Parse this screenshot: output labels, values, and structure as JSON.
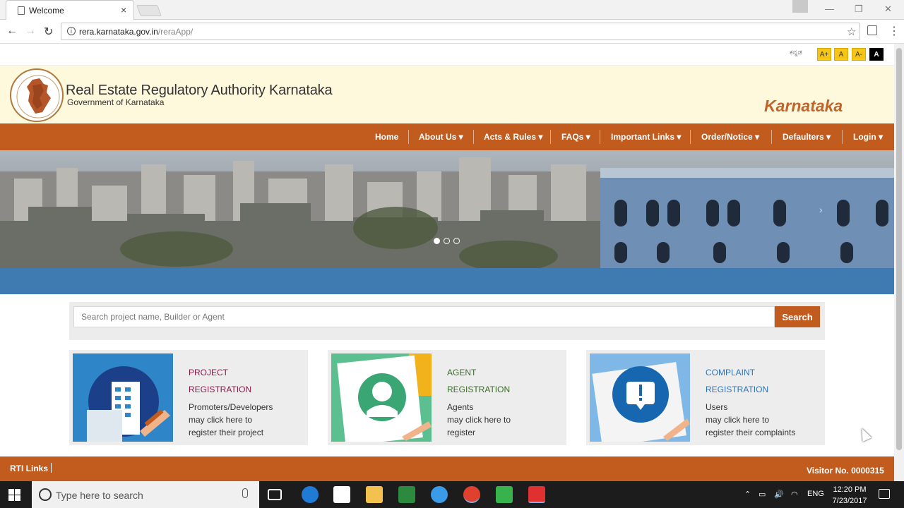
{
  "browser": {
    "tab_title": "Welcome",
    "tab_close": "×",
    "url_host": "rera.karnataka.gov.in",
    "url_path": "/reraApp/"
  },
  "topbar": {
    "language_link": "ಕನ್ನಡ",
    "font_buttons": [
      "A+",
      "A",
      "A-",
      "A"
    ]
  },
  "header": {
    "org_title": "Real Estate Regulatory Authority Karnataka",
    "org_subtitle": "Government of Karnataka",
    "state_name": "Karnataka"
  },
  "nav": {
    "items": [
      {
        "label": "Home"
      },
      {
        "label": "About Us ▾"
      },
      {
        "label": "Acts & Rules ▾"
      },
      {
        "label": "FAQs ▾"
      },
      {
        "label": "Important Links ▾"
      },
      {
        "label": "Order/Notice ▾"
      },
      {
        "label": "Defaulters ▾"
      },
      {
        "label": "Login ▾"
      }
    ]
  },
  "carousel": {
    "slide_count": 3,
    "active_index": 0
  },
  "search": {
    "placeholder": "Search project name, Builder or Agent",
    "button_label": "Search"
  },
  "cards": [
    {
      "title_line1": "PROJECT",
      "title_line2": "REGISTRATION",
      "desc_line1": "Promoters/Developers",
      "desc_line2": "may click here to",
      "desc_line3": "register their project",
      "title_color": "#8b1a4a"
    },
    {
      "title_line1": "AGENT",
      "title_line2": "REGISTRATION",
      "desc_line1": "Agents",
      "desc_line2": "may click here to",
      "desc_line3": "register",
      "title_color": "#3b6b2a"
    },
    {
      "title_line1": "COMPLAINT",
      "title_line2": "REGISTRATION",
      "desc_line1": "Users",
      "desc_line2": "may click here to",
      "desc_line3": "register their complaints",
      "title_color": "#2e73b8"
    }
  ],
  "footer": {
    "rti_link": "RTI Links",
    "visitor_label": "Visitor No. 0000315"
  },
  "taskbar": {
    "search_placeholder": "Type here to search",
    "language": "ENG",
    "time": "12:20 PM",
    "date": "7/23/2017"
  },
  "colors": {
    "brand_orange": "#c25b1e",
    "header_cream": "#fef8dc",
    "band_blue": "#3f7ab0"
  }
}
